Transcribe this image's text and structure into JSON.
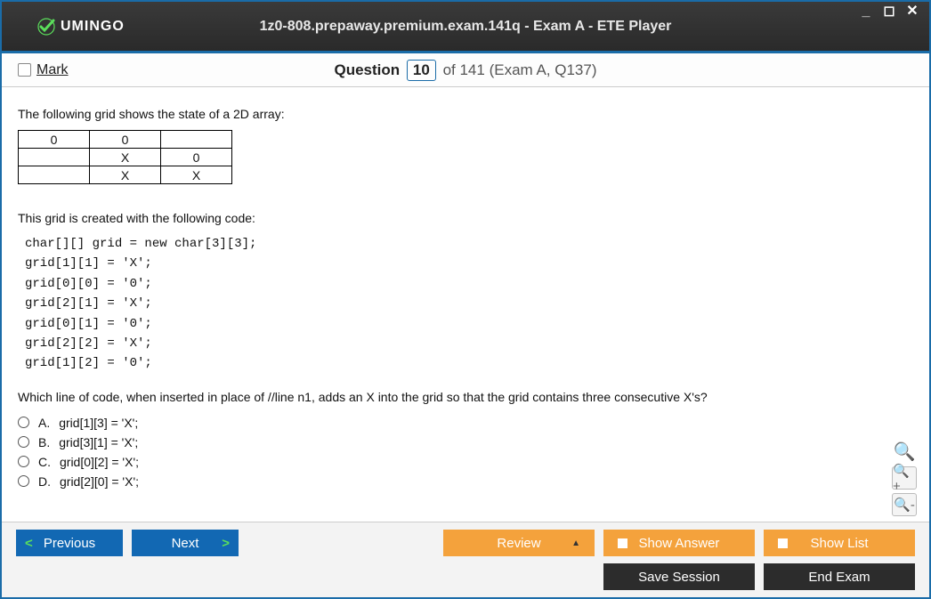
{
  "window": {
    "title": "1z0-808.prepaway.premium.exam.141q - Exam A - ETE Player",
    "brand": "UMINGO"
  },
  "header": {
    "mark_label": "Mark",
    "question_word": "Question",
    "current": "10",
    "total_text": "of 141",
    "exam_ref": "(Exam A, Q137)"
  },
  "question": {
    "intro": "The following grid shows the state of a 2D array:",
    "grid": [
      [
        "0",
        "0",
        ""
      ],
      [
        "",
        "X",
        "0"
      ],
      [
        "",
        "X",
        "X"
      ]
    ],
    "code_intro": "This grid is created with the following code:",
    "code": "char[][] grid = new char[3][3];\ngrid[1][1] = 'X';\ngrid[0][0] = '0';\ngrid[2][1] = 'X';\ngrid[0][1] = '0';\ngrid[2][2] = 'X';\ngrid[1][2] = '0';",
    "prompt": "Which line of code, when inserted in place of //line n1, adds an X into the grid so that the grid contains three consecutive X's?",
    "options": [
      {
        "letter": "A.",
        "text": "grid[1][3] = 'X';"
      },
      {
        "letter": "B.",
        "text": "grid[3][1] = 'X';"
      },
      {
        "letter": "C.",
        "text": "grid[0][2] = 'X';"
      },
      {
        "letter": "D.",
        "text": "grid[2][0] = 'X';"
      }
    ]
  },
  "footer": {
    "previous": "Previous",
    "next": "Next",
    "review": "Review",
    "show_answer": "Show Answer",
    "show_list": "Show List",
    "save_session": "Save Session",
    "end_exam": "End Exam"
  }
}
